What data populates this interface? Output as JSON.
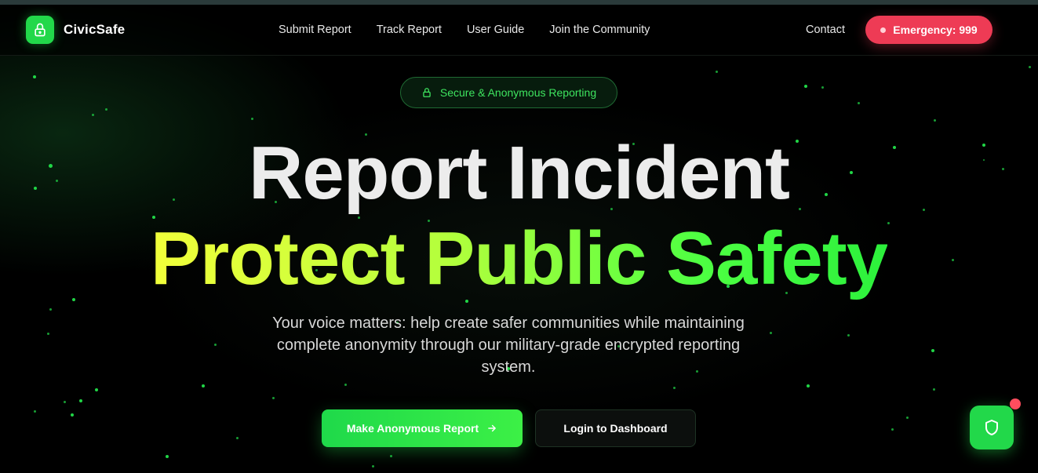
{
  "header": {
    "brand": "CivicSafe",
    "nav": [
      "Submit Report",
      "Track Report",
      "User Guide",
      "Join the Community"
    ],
    "contact": "Contact",
    "emergency": "Emergency: 999"
  },
  "hero": {
    "badge": "Secure & Anonymous Reporting",
    "title_line1": "Report Incident",
    "title_line2": "Protect Public Safety",
    "subtitle": "Your voice matters: help create safer communities while maintaining complete anonymity through our military-grade encrypted reporting system.",
    "primary_button": "Make Anonymous Report",
    "secondary_button": "Login to Dashboard"
  },
  "colors": {
    "accent": "#22d84a",
    "emergency": "#ee3b55",
    "gradient_start": "#f2ff3a",
    "gradient_end": "#2cf03c"
  },
  "icons": {
    "logo": "lock-icon",
    "badge": "lock-icon",
    "primary_button": "arrow-right-icon",
    "floating_button": "shield-icon"
  }
}
